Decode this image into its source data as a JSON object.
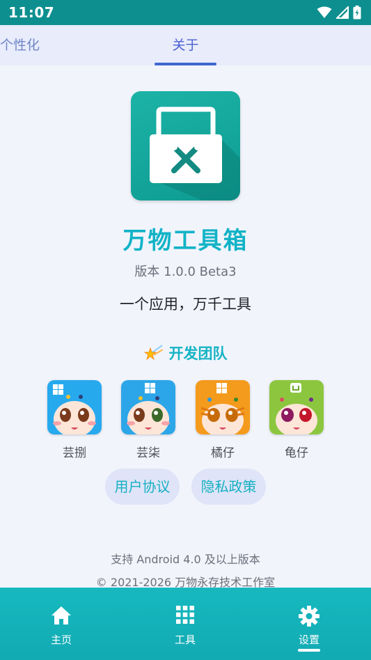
{
  "status_bar": {
    "time": "11:07"
  },
  "tabs": [
    {
      "label": "个性化",
      "active": false
    },
    {
      "label": "关于",
      "active": true
    }
  ],
  "app": {
    "name": "万物工具箱",
    "version": "版本 1.0.0 Beta3",
    "slogan": "一个应用，万千工具"
  },
  "team": {
    "title": "开发团队",
    "members": [
      {
        "name": "芸捌"
      },
      {
        "name": "芸柒"
      },
      {
        "name": "橘仔"
      },
      {
        "name": "龟仔"
      }
    ]
  },
  "links": {
    "agreement": "用户协议",
    "privacy": "隐私政策"
  },
  "footer": {
    "support": "支持 Android 4.0 及以上版本",
    "copyright": "© 2021-2026 万物永存技术工作室"
  },
  "bottom_nav": [
    {
      "label": "主页",
      "icon": "home-icon"
    },
    {
      "label": "工具",
      "icon": "grid-icon"
    },
    {
      "label": "设置",
      "icon": "gear-icon",
      "active": true
    }
  ],
  "colors": {
    "status_bar": "#0e8f8f",
    "accent": "#15b3c4",
    "tab_active": "#3d66cf",
    "bottom_nav": "#14b2b9"
  }
}
